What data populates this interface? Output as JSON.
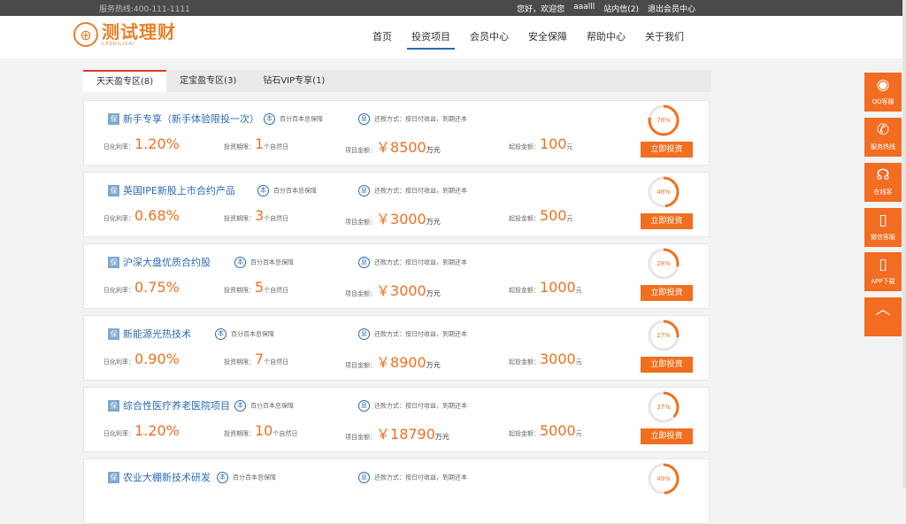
{
  "topbar": {
    "hotline": "服务热线:400-111-1111",
    "greeting": "您好，欢迎您",
    "username": "aaalll",
    "messages": "站内信(2)",
    "logout": "退出会员中心"
  },
  "logo": {
    "cn": "测试理财",
    "en": "CESHILICAI"
  },
  "nav": [
    "首页",
    "投资项目",
    "会员中心",
    "安全保障",
    "帮助中心",
    "关于我们"
  ],
  "tabs": [
    "天天盈专区(8)",
    "定宝盈专区(3)",
    "钻石VIP专享(1)"
  ],
  "labels": {
    "badge": "保",
    "guarantee_icon": "本",
    "guarantee": "百分百本息保障",
    "repay_icon": "息",
    "repay": "还款方式：按日付收益，到期还本",
    "rate": "日化利率：",
    "term": "投资期限：",
    "term_unit": "个自然日",
    "amount": "项目金额：",
    "amount_prefix": "￥",
    "amount_unit": "万元",
    "min": "起投金额：",
    "min_unit": "元",
    "invest_button": "立即投资"
  },
  "products": [
    {
      "name": "新手专享（新手体验限投一次）",
      "rate": "1.20%",
      "term": "1",
      "amount": "8500",
      "min": "100",
      "progress": "78%",
      "progress_value": 78
    },
    {
      "name": "英国IPE新股上市合约产品",
      "rate": "0.68%",
      "term": "3",
      "amount": "3000",
      "min": "500",
      "progress": "48%",
      "progress_value": 48
    },
    {
      "name": "沪深大盘优质合约股",
      "rate": "0.75%",
      "term": "5",
      "amount": "3000",
      "min": "1000",
      "progress": "28%",
      "progress_value": 28
    },
    {
      "name": "新能源光热技术",
      "rate": "0.90%",
      "term": "7",
      "amount": "8900",
      "min": "3000",
      "progress": "27%",
      "progress_value": 27
    },
    {
      "name": "综合性医疗养老医院项目",
      "rate": "1.20%",
      "term": "10",
      "amount": "18790",
      "min": "5000",
      "progress": "37%",
      "progress_value": 37
    },
    {
      "name": "农业大棚新技术研发",
      "progress": "49%",
      "progress_value": 49
    }
  ],
  "sidebar": [
    {
      "label": "QQ客服",
      "icon": "qq-icon"
    },
    {
      "label": "服务热线",
      "icon": "phone-icon"
    },
    {
      "label": "在线客",
      "icon": "headset-icon"
    },
    {
      "label": "微信客服",
      "icon": "mobile-icon"
    },
    {
      "label": "APP下载",
      "icon": "mobile-download-icon"
    },
    {
      "label": "",
      "icon": "back-to-top-icon"
    }
  ],
  "colors": {
    "accent": "#f07020",
    "link": "#2a6bb5",
    "tab_active": "#e03a2a",
    "side": "#f26c22"
  }
}
